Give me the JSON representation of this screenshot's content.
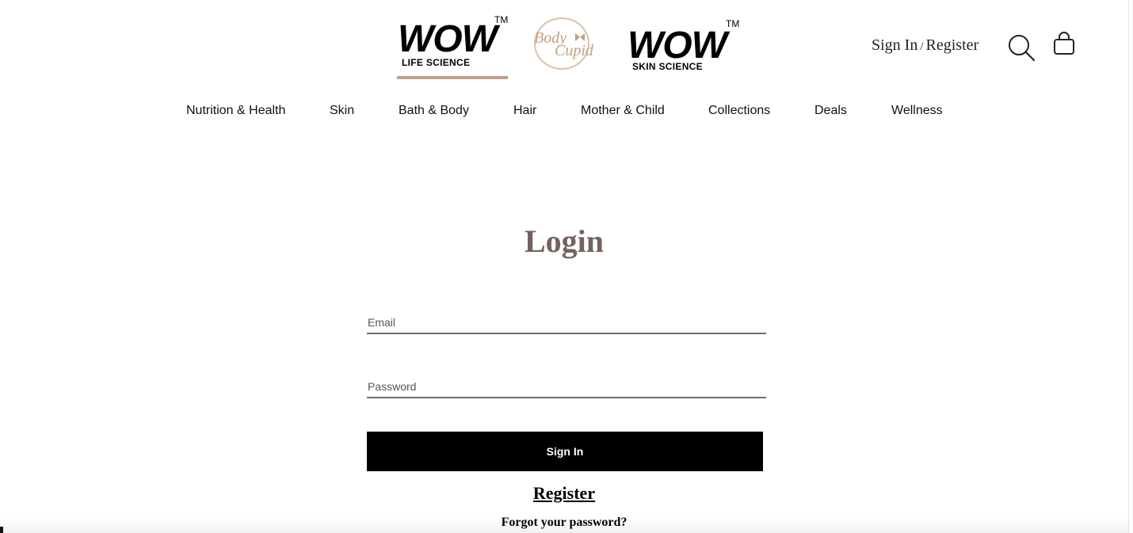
{
  "header": {
    "brands": [
      {
        "wordmark": "WOW",
        "tm": "TM",
        "subtitle": "LIFE SCIENCE",
        "active": true
      },
      {
        "line1": "Body",
        "line2": "Cupid"
      },
      {
        "wordmark": "WOW",
        "tm": "TM",
        "subtitle": "SKIN SCIENCE",
        "active": false
      }
    ],
    "sign_in_label": "Sign In",
    "separator": "/",
    "register_label": "Register",
    "search_icon": "search-icon",
    "cart_icon": "shopping-bag-icon",
    "accent_color": "#c39d8c"
  },
  "nav": {
    "items": [
      {
        "label": "Nutrition & Health"
      },
      {
        "label": "Skin"
      },
      {
        "label": "Bath & Body"
      },
      {
        "label": "Hair"
      },
      {
        "label": "Mother & Child"
      },
      {
        "label": "Collections"
      },
      {
        "label": "Deals"
      },
      {
        "label": "Wellness"
      }
    ]
  },
  "login": {
    "title": "Login",
    "title_color": "#75625d",
    "email": {
      "placeholder": "Email",
      "value": ""
    },
    "password": {
      "placeholder": "Password",
      "value": ""
    },
    "submit_label": "Sign In",
    "register_label": "Register",
    "forgot_label": "Forgot your password?"
  }
}
